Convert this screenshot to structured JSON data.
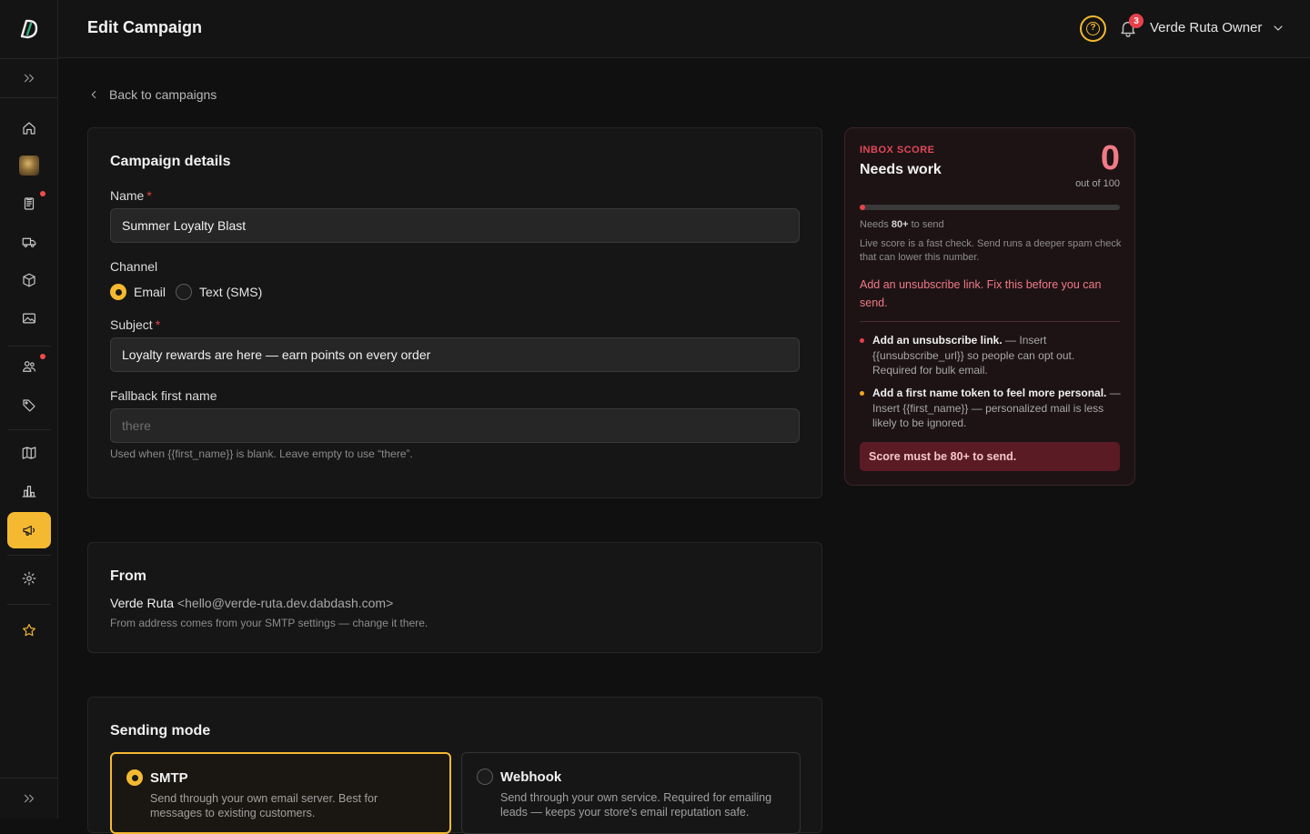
{
  "app": {
    "page_title": "Edit Campaign",
    "notifications_count": "3",
    "user_name": "Verde Ruta Owner",
    "help_label": "?"
  },
  "sidebar": {
    "items": [
      {
        "icon": "home-icon"
      },
      {
        "icon": "store-thumbnail"
      },
      {
        "icon": "orders-icon"
      },
      {
        "icon": "delivery-truck-icon"
      },
      {
        "icon": "box-icon"
      },
      {
        "icon": "image-icon"
      },
      {
        "icon": "customers-icon"
      },
      {
        "icon": "tag-icon"
      },
      {
        "icon": "book-icon"
      },
      {
        "icon": "analytics-icon"
      },
      {
        "icon": "megaphone-icon"
      },
      {
        "icon": "gear-icon"
      },
      {
        "icon": "star-icon"
      }
    ],
    "active": "megaphone-icon"
  },
  "nav": {
    "back_label": "Back to campaigns"
  },
  "details": {
    "title": "Campaign details",
    "name_label": "Name",
    "name_value": "Summer Loyalty Blast",
    "channel_label": "Channel",
    "channel_options": [
      "Email",
      "Text (SMS)"
    ],
    "channel_selected": "Email",
    "subject_label": "Subject",
    "subject_value": "Loyalty rewards are here — earn points on every order",
    "fallback_label": "Fallback first name",
    "fallback_placeholder": "there",
    "fallback_helper": "Used when {{first_name}} is blank. Leave empty to use “there”.",
    "required_mark": "*"
  },
  "from": {
    "title": "From",
    "sender_name": "Verde Ruta",
    "sender_email": "<hello@verde-ruta.dev.dabdash.com>",
    "note": "From address comes from your SMTP settings — change it there."
  },
  "sending_mode": {
    "title": "Sending mode",
    "options": [
      {
        "title": "SMTP",
        "desc": "Send through your own email server. Best for messages to existing customers.",
        "selected": true
      },
      {
        "title": "Webhook",
        "desc": "Send through your own service. Required for emailing leads — keeps your store's email reputation safe.",
        "selected": false
      }
    ]
  },
  "inbox_score": {
    "kicker": "INBOX SCORE",
    "status": "Needs work",
    "score": "0",
    "out_of": "out of 100",
    "fill_percent": 2,
    "threshold_prefix": "Needs ",
    "threshold_value": "80+",
    "threshold_suffix": " to send",
    "live_note": "Live score is a fast check. Send runs a deeper spam check that can lower this number.",
    "warning": "Add an unsubscribe link. Fix this before you can send.",
    "tips": [
      {
        "title": "Add an unsubscribe link.",
        "body": " — Insert {{unsubscribe_url}} so people can opt out. Required for bulk email.",
        "color": "#e8414b"
      },
      {
        "title": "Add a first name token to feel more personal.",
        "body": " — Insert {{first_name}} — personalized mail is less likely to be ignored.",
        "color": "#f5a623"
      }
    ],
    "alert": "Score must be 80+ to send."
  },
  "colors": {
    "accent": "#f5b931",
    "danger": "#e8414b",
    "background": "#101010",
    "surface": "#161616"
  }
}
